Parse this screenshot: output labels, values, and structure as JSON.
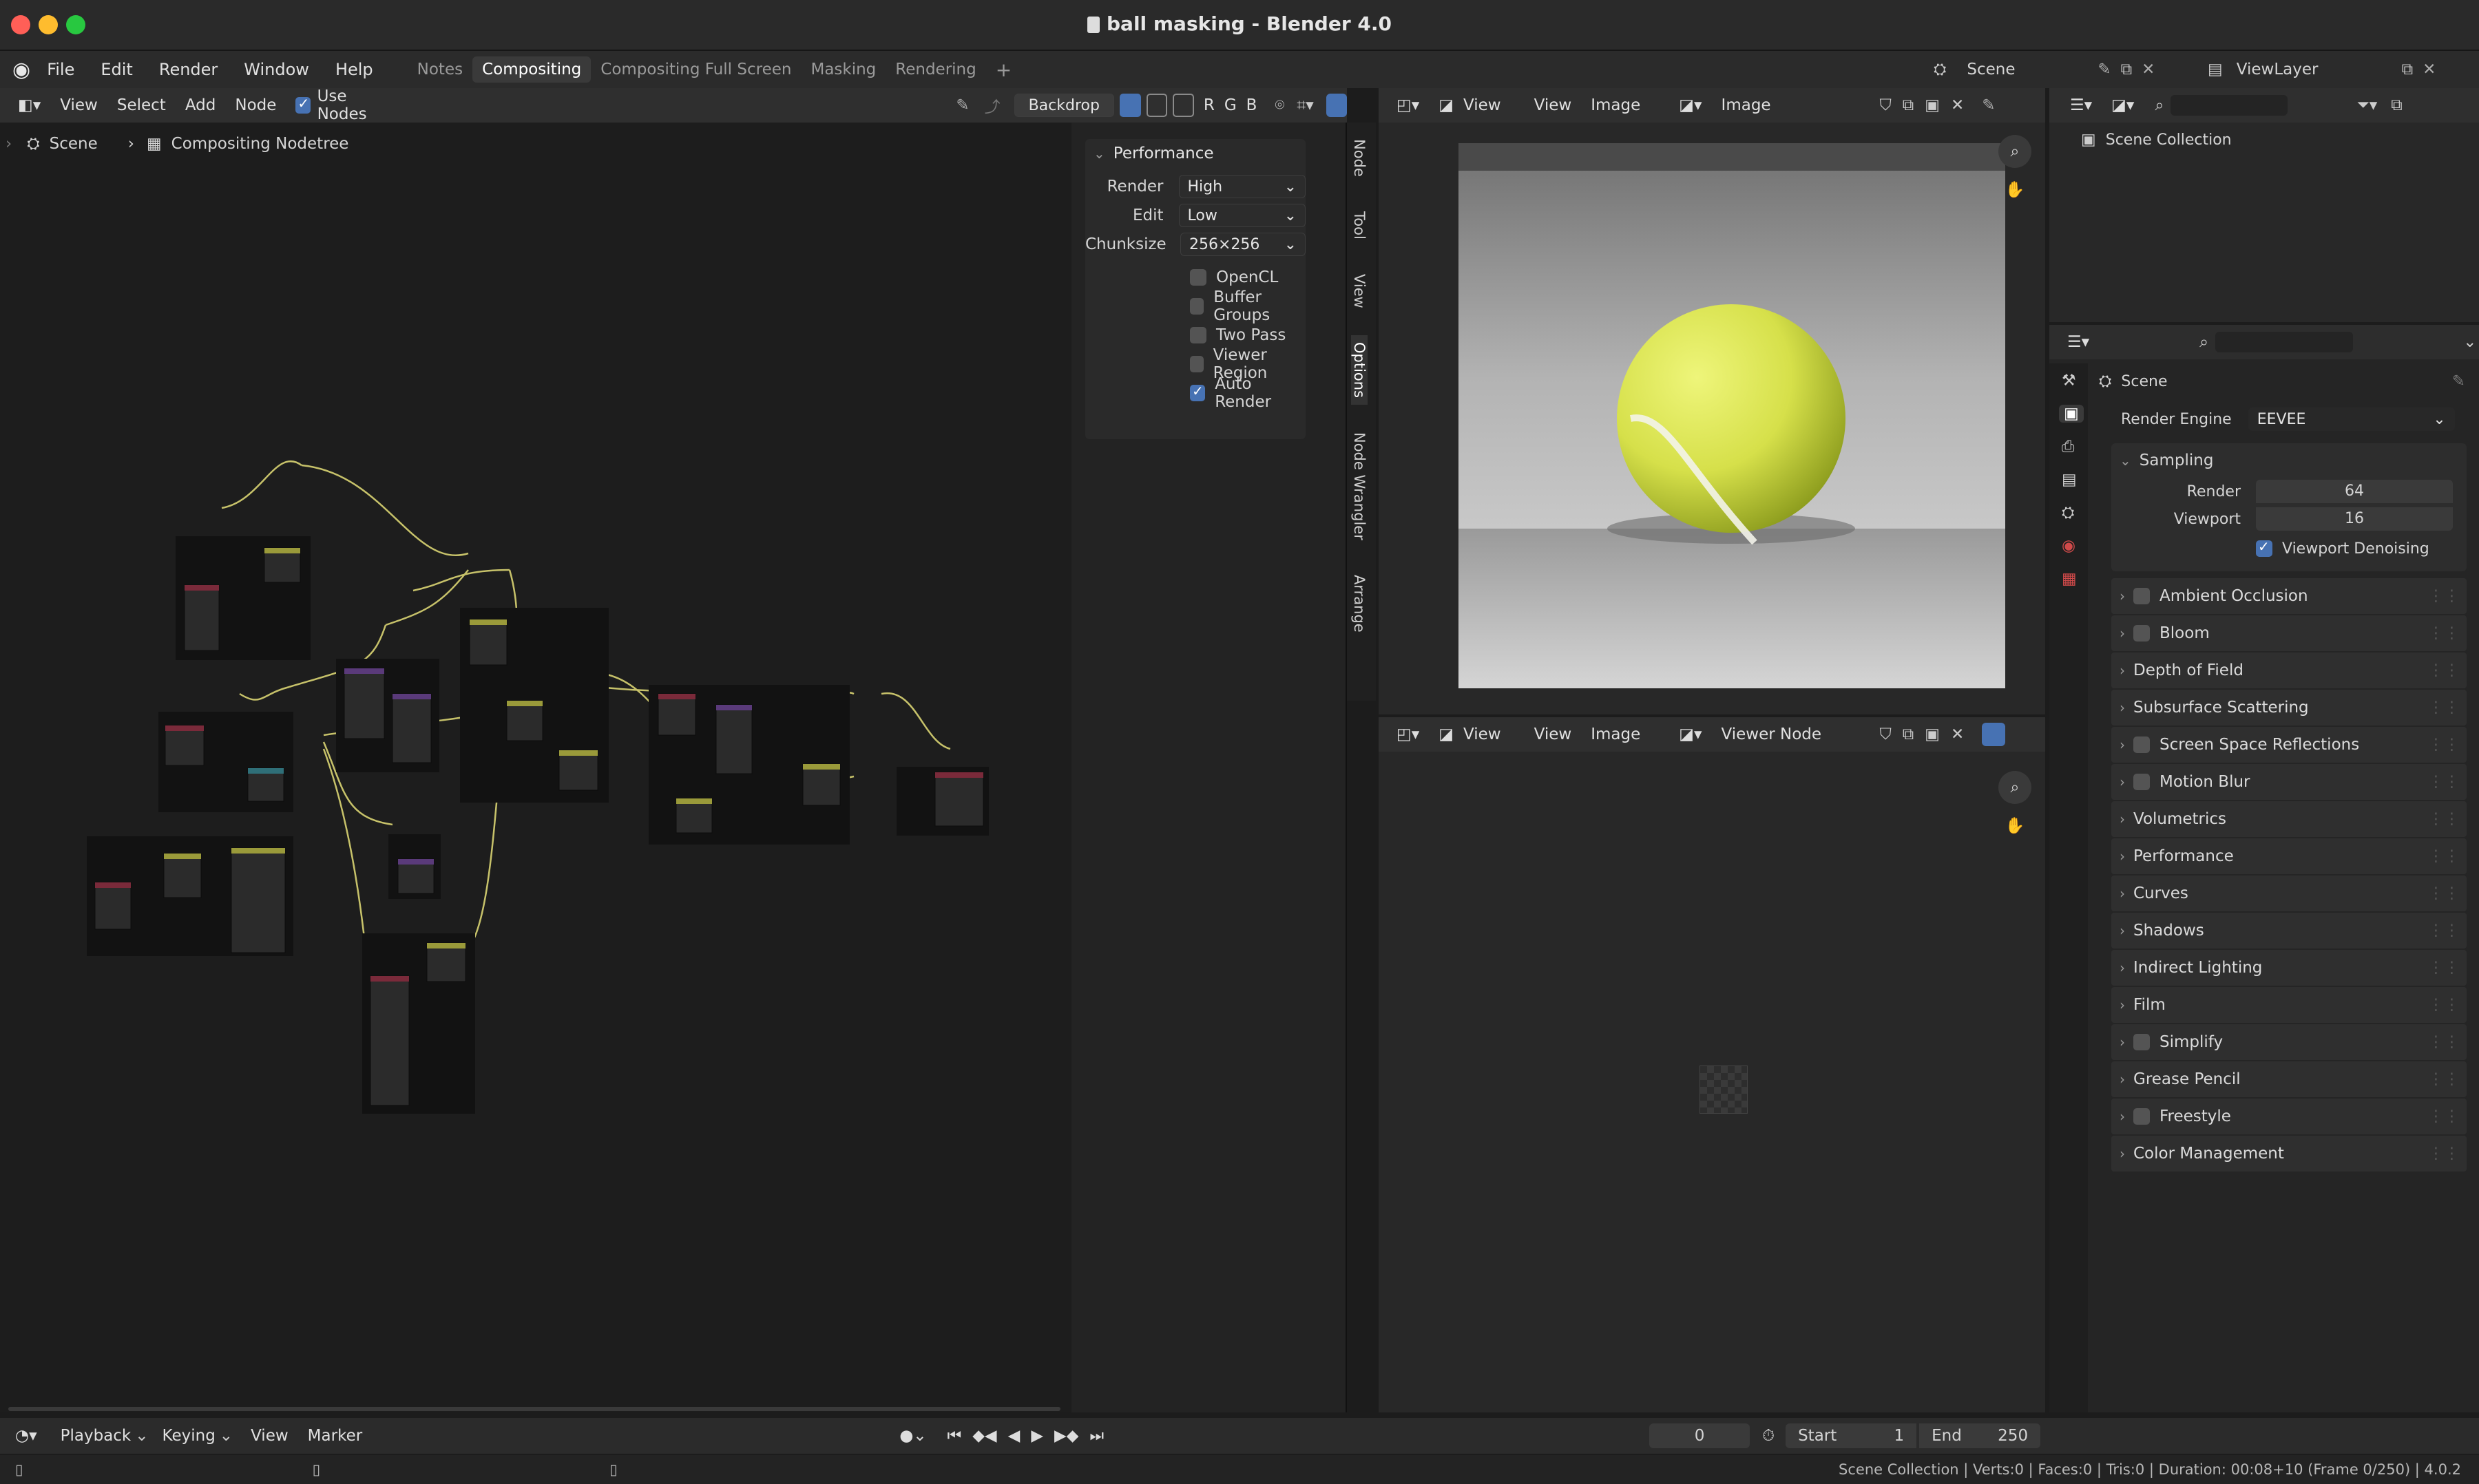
{
  "window": {
    "title": "ball masking - Blender 4.0"
  },
  "menu": {
    "items": [
      "File",
      "Edit",
      "Render",
      "Window",
      "Help"
    ]
  },
  "workspaces": [
    "Notes",
    "Compositing",
    "Compositing Full Screen",
    "Masking",
    "Rendering"
  ],
  "active_workspace": "Compositing",
  "topright": {
    "scene": "Scene",
    "viewlayer": "ViewLayer"
  },
  "node_editor": {
    "menu": [
      "View",
      "Select",
      "Add",
      "Node"
    ],
    "use_nodes": "Use Nodes",
    "backdrop": "Backdrop",
    "channels": [
      "R",
      "G",
      "B"
    ],
    "breadcrumb": [
      "Scene",
      "Compositing Nodetree"
    ]
  },
  "performance": {
    "title": "Performance",
    "render_label": "Render",
    "render_value": "High",
    "edit_label": "Edit",
    "edit_value": "Low",
    "chunk_label": "Chunksize",
    "chunk_value": "256×256",
    "options": [
      {
        "label": "OpenCL",
        "checked": false
      },
      {
        "label": "Buffer Groups",
        "checked": false
      },
      {
        "label": "Two Pass",
        "checked": false
      },
      {
        "label": "Viewer Region",
        "checked": false
      },
      {
        "label": "Auto Render",
        "checked": true
      }
    ]
  },
  "side_tabs": [
    "Node",
    "Tool",
    "View",
    "Options",
    "Node Wrangler",
    "Arrange"
  ],
  "image_editor_top": {
    "menu": [
      "View",
      "View",
      "Image"
    ],
    "image_name": "Image"
  },
  "image_editor_bottom": {
    "menu": [
      "View",
      "View",
      "Image"
    ],
    "image_name": "Viewer Node"
  },
  "outliner": {
    "collection": "Scene Collection"
  },
  "properties": {
    "scene": "Scene",
    "render_engine_label": "Render Engine",
    "render_engine": "EEVEE",
    "sampling": "Sampling",
    "render_label": "Render",
    "render_value": "64",
    "viewport_label": "Viewport",
    "viewport_value": "16",
    "viewport_denoising": "Viewport Denoising",
    "sections": [
      {
        "label": "Ambient Occlusion",
        "checkbox": true
      },
      {
        "label": "Bloom",
        "checkbox": true
      },
      {
        "label": "Depth of Field",
        "checkbox": false
      },
      {
        "label": "Subsurface Scattering",
        "checkbox": false
      },
      {
        "label": "Screen Space Reflections",
        "checkbox": true
      },
      {
        "label": "Motion Blur",
        "checkbox": true
      },
      {
        "label": "Volumetrics",
        "checkbox": false
      },
      {
        "label": "Performance",
        "checkbox": false
      },
      {
        "label": "Curves",
        "checkbox": false
      },
      {
        "label": "Shadows",
        "checkbox": false
      },
      {
        "label": "Indirect Lighting",
        "checkbox": false
      },
      {
        "label": "Film",
        "checkbox": false
      },
      {
        "label": "Simplify",
        "checkbox": true
      },
      {
        "label": "Grease Pencil",
        "checkbox": false
      },
      {
        "label": "Freestyle",
        "checkbox": true
      },
      {
        "label": "Color Management",
        "checkbox": false
      }
    ]
  },
  "timeline": {
    "menu": [
      "Playback",
      "Keying",
      "View",
      "Marker"
    ],
    "current_frame": "0",
    "start_label": "Start",
    "start": "1",
    "end_label": "End",
    "end": "250"
  },
  "status": "Scene Collection | Verts:0 | Faces:0 | Tris:0 | Duration: 00:08+10 (Frame 0/250) | 4.0.2",
  "colors": {
    "accent": "#4772b3",
    "ball": "#d6e04a",
    "wire": "#c7c26a"
  }
}
